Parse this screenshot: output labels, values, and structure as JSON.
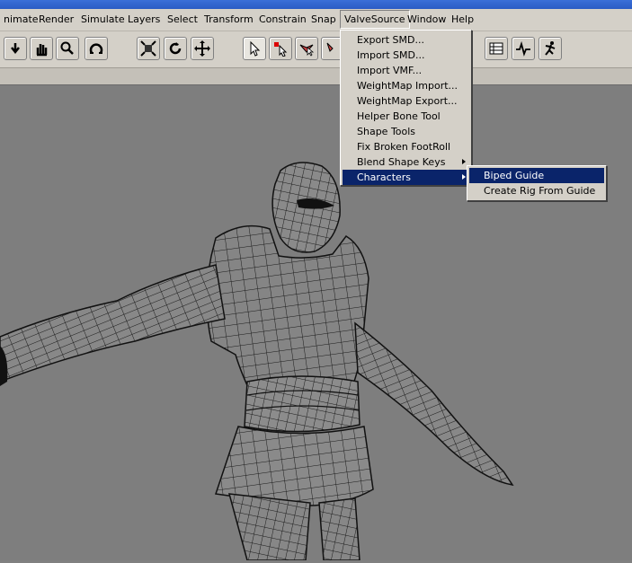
{
  "menubar": {
    "items": [
      "nimate",
      "Render",
      "Simulate",
      "Layers",
      "Select",
      "Transform",
      "Constrain",
      "Snap",
      "ValveSource",
      "Window",
      "Help"
    ]
  },
  "toolbar": {
    "icons": [
      "down-arrow-icon",
      "hand-icon",
      "magnifier-icon",
      "orbit-icon",
      "fit-view-icon",
      "rotate-icon",
      "move-icon",
      "select-arrow-icon",
      "select-red-icon",
      "lasso-select-icon",
      "paint-select-icon",
      "grid-panel-icon",
      "graph-editor-icon",
      "curve-icon",
      "character-pose-icon"
    ]
  },
  "valvesource_menu": {
    "items": [
      {
        "label": "Export SMD...",
        "submenu": false
      },
      {
        "label": "Import SMD...",
        "submenu": false
      },
      {
        "label": "Import VMF...",
        "submenu": false
      },
      {
        "label": "WeightMap Import...",
        "submenu": false
      },
      {
        "label": "WeightMap Export...",
        "submenu": false
      },
      {
        "label": "Helper Bone Tool",
        "submenu": false
      },
      {
        "label": "Shape Tools",
        "submenu": false
      },
      {
        "label": "Fix Broken FootRoll",
        "submenu": false
      },
      {
        "label": "Blend Shape Keys",
        "submenu": true
      },
      {
        "label": "Characters",
        "submenu": true,
        "highlighted": true
      }
    ]
  },
  "characters_submenu": {
    "items": [
      {
        "label": "Biped Guide",
        "highlighted": true
      },
      {
        "label": "Create Rig From Guide",
        "highlighted": false
      }
    ]
  },
  "colors": {
    "menu_bg": "#d4d0c8",
    "highlight": "#0a246a",
    "viewport_bg": "#7e7e7e",
    "wire": "#1a1a1a"
  }
}
